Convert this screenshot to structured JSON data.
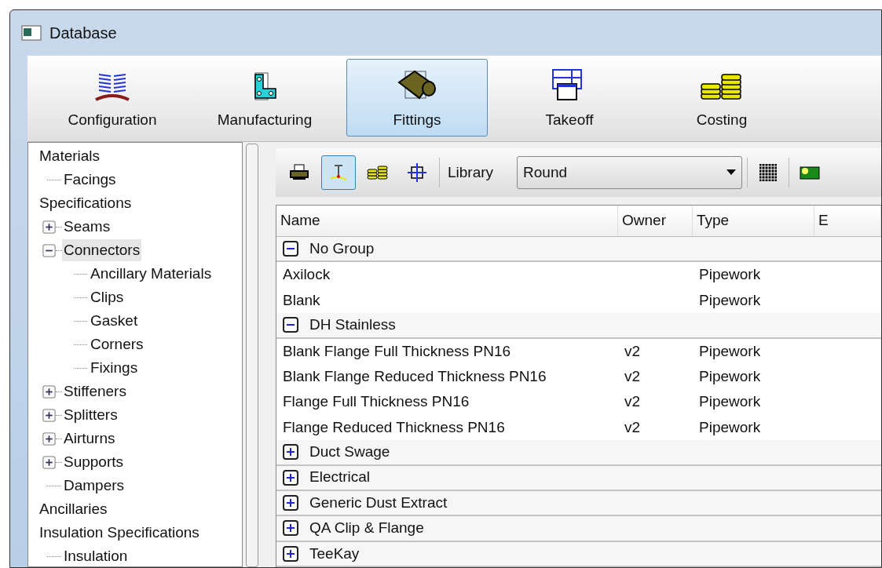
{
  "window": {
    "title": "Database"
  },
  "ribbon": [
    {
      "kind": "book",
      "label": "Configuration",
      "selected": false
    },
    {
      "kind": "bracket",
      "label": "Manufacturing",
      "selected": false
    },
    {
      "kind": "fitting",
      "label": "Fittings",
      "selected": true
    },
    {
      "kind": "sheets",
      "label": "Takeoff",
      "selected": false
    },
    {
      "kind": "coins",
      "label": "Costing",
      "selected": false
    }
  ],
  "tree": [
    {
      "label": "Materials",
      "selected": false,
      "children": [
        {
          "label": "Facings",
          "selected": false
        }
      ]
    },
    {
      "label": "Specifications",
      "selected": false,
      "children": [
        {
          "label": "Seams",
          "selected": false,
          "expanded": false
        },
        {
          "label": "Connectors",
          "selected": true,
          "expanded": true,
          "children": [
            {
              "label": "Ancillary Materials",
              "selected": false
            },
            {
              "label": "Clips",
              "selected": false
            },
            {
              "label": "Gasket",
              "selected": false
            },
            {
              "label": "Corners",
              "selected": false
            },
            {
              "label": "Fixings",
              "selected": false
            }
          ]
        },
        {
          "label": "Stiffeners",
          "selected": false,
          "expanded": false
        },
        {
          "label": "Splitters",
          "selected": false,
          "expanded": false
        },
        {
          "label": "Airturns",
          "selected": false,
          "expanded": false
        },
        {
          "label": "Supports",
          "selected": false,
          "expanded": false
        },
        {
          "label": "Dampers",
          "selected": false
        }
      ]
    },
    {
      "label": "Ancillaries",
      "selected": false
    },
    {
      "label": "Insulation Specifications",
      "selected": false,
      "children": [
        {
          "label": "Insulation",
          "selected": false
        }
      ]
    }
  ],
  "toolbar": {
    "tools": [
      {
        "kind": "print",
        "selected": false
      },
      {
        "kind": "insert",
        "selected": true
      },
      {
        "kind": "coins",
        "selected": false
      },
      {
        "kind": "crosshair",
        "selected": false
      }
    ],
    "library_label": "Library",
    "library_value": "Round",
    "extra_tools": [
      {
        "kind": "grid",
        "selected": false
      },
      {
        "kind": "green",
        "selected": false
      }
    ]
  },
  "table": {
    "columns": [
      "Name",
      "Owner",
      "Type",
      "E"
    ],
    "groups": [
      {
        "name": "No Group",
        "expanded": true,
        "rows": [
          [
            "Axilock",
            "",
            "Pipework"
          ],
          [
            "Blank",
            "",
            "Pipework"
          ]
        ]
      },
      {
        "name": "DH Stainless",
        "expanded": true,
        "rows": [
          [
            "Blank Flange Full Thickness PN16",
            "v2",
            "Pipework"
          ],
          [
            "Blank Flange Reduced Thickness PN16",
            "v2",
            "Pipework"
          ],
          [
            "Flange Full Thickness PN16",
            "v2",
            "Pipework"
          ],
          [
            "Flange Reduced Thickness PN16",
            "v2",
            "Pipework"
          ]
        ]
      },
      {
        "name": "Duct Swage",
        "expanded": false
      },
      {
        "name": "Electrical",
        "expanded": false
      },
      {
        "name": "Generic Dust Extract",
        "expanded": false
      },
      {
        "name": "QA Clip & Flange",
        "expanded": false
      },
      {
        "name": "TeeKay",
        "expanded": false
      }
    ]
  }
}
